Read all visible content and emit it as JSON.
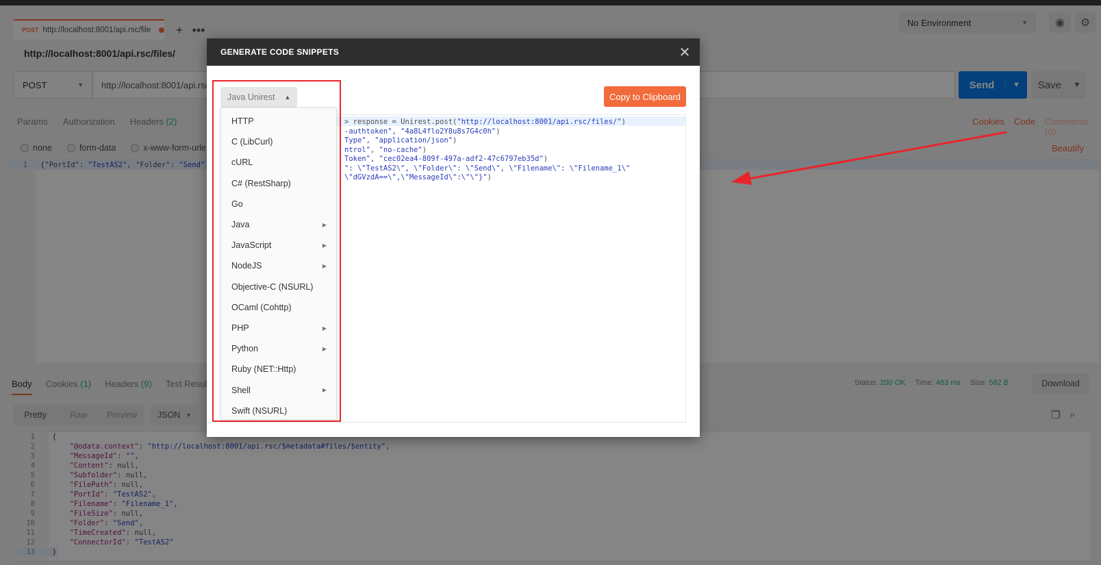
{
  "app": {
    "request_tab": {
      "method": "POST",
      "url": "http://localhost:8001/api.rsc/file"
    },
    "environment": "No Environment",
    "request_title": "http://localhost:8001/api.rsc/files/",
    "method": "POST",
    "url_value": "http://localhost:8001/api.rsc",
    "send_label": "Send",
    "save_label": "Save",
    "req_tabs": {
      "params": "Params",
      "authorization": "Authorization",
      "headers": "Headers",
      "headers_count": "(2)"
    },
    "right_links": {
      "cookies": "Cookies",
      "code": "Code",
      "comments": "Comments (0)"
    },
    "body_types": {
      "none": "none",
      "form_data": "form-data",
      "urlencoded": "x-www-form-urle"
    },
    "beautify": "Beautify",
    "request_body_line": {
      "num": "1",
      "p1": "{\"PortId\": ",
      "p2": "\"TestAS2\"",
      "p3": ", \"Folder\": ",
      "p4": "\"Send\""
    },
    "resp_tabs": {
      "body": "Body",
      "cookies": "Cookies",
      "cookies_count": "(1)",
      "headers": "Headers",
      "headers_count": "(9)",
      "test_results": "Test Results"
    },
    "status": {
      "status_label": "Status:",
      "status_value": "200 OK",
      "time_label": "Time:",
      "time_value": "483 ms",
      "size_label": "Size:",
      "size_value": "582 B"
    },
    "download": "Download",
    "view_tabs": {
      "pretty": "Pretty",
      "raw": "Raw",
      "preview": "Preview"
    },
    "format": "JSON",
    "response_lines": [
      {
        "n": "1",
        "text": "{"
      },
      {
        "n": "2",
        "key": "\"@odata.context\"",
        "val": "\"http://localhost:8001/api.rsc/$metadata#files/$entity\"",
        "end": ","
      },
      {
        "n": "3",
        "key": "\"MessageId\"",
        "val": "\"\"",
        "end": ","
      },
      {
        "n": "4",
        "key": "\"Content\"",
        "val": "null",
        "end": ","
      },
      {
        "n": "5",
        "key": "\"Subfolder\"",
        "val": "null",
        "end": ","
      },
      {
        "n": "6",
        "key": "\"FilePath\"",
        "val": "null",
        "end": ","
      },
      {
        "n": "7",
        "key": "\"PortId\"",
        "val": "\"TestAS2\"",
        "end": ","
      },
      {
        "n": "8",
        "key": "\"Filename\"",
        "val": "\"Filename_1\"",
        "end": ","
      },
      {
        "n": "9",
        "key": "\"FileSize\"",
        "val": "null",
        "end": ","
      },
      {
        "n": "10",
        "key": "\"Folder\"",
        "val": "\"Send\"",
        "end": ","
      },
      {
        "n": "11",
        "key": "\"TimeCreated\"",
        "val": "null",
        "end": ","
      },
      {
        "n": "12",
        "key": "\"ConnectorId\"",
        "val": "\"TestAS2\"",
        "end": ""
      },
      {
        "n": "13",
        "text": "}"
      }
    ]
  },
  "modal": {
    "title": "GENERATE CODE SNIPPETS",
    "selected_language": "Java Unirest",
    "copy_label": "Copy to Clipboard",
    "snippet_lines": [
      {
        "a": "> response = Unirest.post(",
        "b": "\"http://localhost:8001/api.rsc/files/\"",
        "c": ")"
      },
      {
        "a": "",
        "b": "-authtoken\", \"4a8L4flo2Y8u8s7G4c0h\"",
        "c": ")"
      },
      {
        "a": "",
        "b": "Type\", \"application/json\"",
        "c": ")"
      },
      {
        "a": "",
        "b": "ntrol\", \"no-cache\"",
        "c": ")"
      },
      {
        "a": "",
        "b": "Token\", \"cec02ea4-809f-497a-adf2-47c6797eb35d\"",
        "c": ")"
      },
      {
        "a": "",
        "b": "\": \\\"TestAS2\\\", \\\"Folder\\\": \\\"Send\\\", \\\"Filename\\\": \\\"Filename_1\\\"",
        "c": ""
      },
      {
        "a": "",
        "b": "\\\"dGVzdA==\\\",\\\"MessageId\\\":\\\"\\\"}\"",
        "c": ")"
      }
    ],
    "languages": [
      {
        "label": "HTTP",
        "submenu": false
      },
      {
        "label": "C (LibCurl)",
        "submenu": false
      },
      {
        "label": "cURL",
        "submenu": false
      },
      {
        "label": "C# (RestSharp)",
        "submenu": false
      },
      {
        "label": "Go",
        "submenu": false
      },
      {
        "label": "Java",
        "submenu": true
      },
      {
        "label": "JavaScript",
        "submenu": true
      },
      {
        "label": "NodeJS",
        "submenu": true
      },
      {
        "label": "Objective-C (NSURL)",
        "submenu": false
      },
      {
        "label": "OCaml (Cohttp)",
        "submenu": false
      },
      {
        "label": "PHP",
        "submenu": true
      },
      {
        "label": "Python",
        "submenu": true
      },
      {
        "label": "Ruby (NET::Http)",
        "submenu": false
      },
      {
        "label": "Shell",
        "submenu": true
      },
      {
        "label": "Swift (NSURL)",
        "submenu": false
      }
    ]
  },
  "annotation_color": "#e8252b",
  "accent_color": "#f26b3a"
}
